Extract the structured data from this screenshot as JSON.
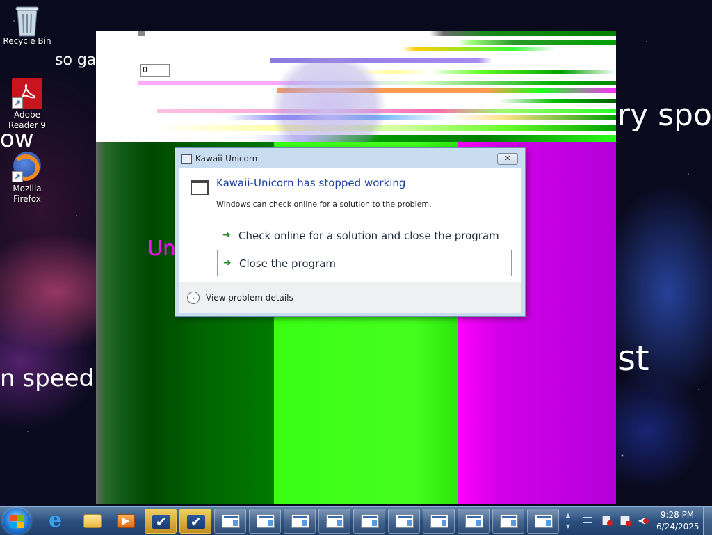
{
  "desktop": {
    "icons": [
      {
        "label": "Recycle Bin"
      },
      {
        "label": "Adobe Reader 9"
      },
      {
        "label": "Mozilla Firefox"
      }
    ],
    "wallpaper_text": {
      "t1": "so gal",
      "t2": "ow",
      "t3": "n speed",
      "t4": "ry spo",
      "t5": "st"
    }
  },
  "glitch_window": {
    "input_value": "0",
    "partial_text": "Un"
  },
  "dialog": {
    "title": "Kawaii-Unicorn",
    "heading": "Kawaii-Unicorn has stopped working",
    "subtext": "Windows can check online for a solution to the problem.",
    "option1": "Check online for a solution and close the program",
    "option2": "Close the program",
    "details": "View problem details",
    "close_glyph": "✕"
  },
  "taskbar": {
    "time": "9:28 PM",
    "date": "6/24/2025"
  },
  "colors": {
    "dialog_heading": "#1a3e9a",
    "lime": "#39ff14",
    "magenta": "#ff00ff",
    "dark_green": "#006400"
  }
}
